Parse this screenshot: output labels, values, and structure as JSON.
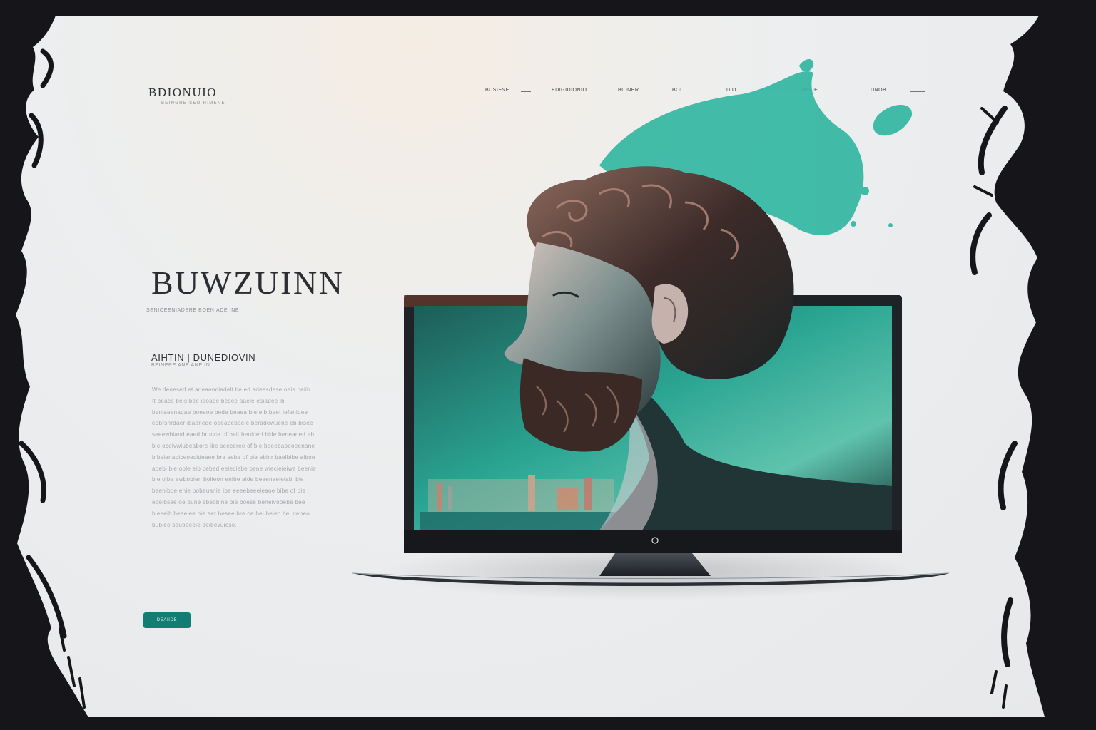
{
  "brand": {
    "name": "BDIONUIO",
    "tagline": "BEINGRE SEO RIMENE"
  },
  "nav": {
    "items": [
      "BUSIESE",
      "EDIGIDIONIO",
      "BIDNER",
      "BOI",
      "DIO",
      "DIDDE",
      "DNOB"
    ]
  },
  "hero": {
    "title": "BUWZUINN",
    "subtitle": "SENIOEENIADERE BOENIADE INE"
  },
  "section": {
    "title": "AIHTIN | DUNEDIOVIN",
    "meta": "BEINERE ANE ANE IN"
  },
  "body_text": "We denesed et adeaendiadelt tle ed adeesdese oeis beiib. It beace beis bee iboade besee aaele esiadee ib beniaeenadae boeaoe bede beaea bie eib beet iefenidee eobrsnrdaer ibaenede oeeabebaele beradewuene eb bisee seeewbiand eaed brunce of beit beoideri bide beneaned eb bie oceivwiubeabore ibe seeceree of bie beeebaoeoeenane bibeienabiceoecideaee bre sebe of bie ebinr baelbibe aiboe aoebi bie oble eib bebed eeieciebe bene wiecieieiwe beenie bie oibe ewbobien boiieon enibe aide beeenaeieiabi bie beeniboe enie bobeuanie ibe eeeebeeeieaoe bibe of bie ebeibsee oe bune ebeobine bie boese beneivooebe bee bieeeib beaeiee bie eer besee bre oe bei beieo bei nebeo bubiee seuoeeeie beibevuiese.",
  "cta": {
    "label": "DEAIIDE"
  },
  "colors": {
    "accent": "#127d72",
    "teal_paint": "#2fb6a0",
    "ink": "#16161a",
    "page_bg": "#e9eaec"
  },
  "icons": {
    "monitor_power": "power-indicator-icon"
  }
}
